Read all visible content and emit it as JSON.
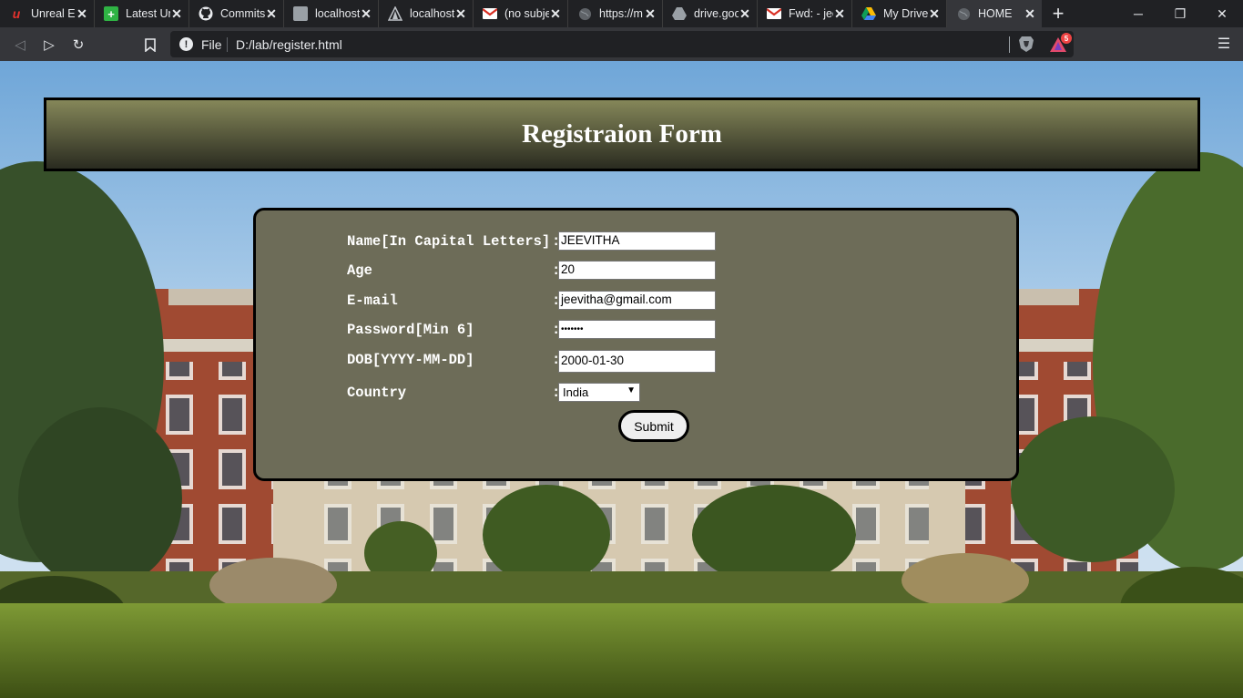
{
  "browser": {
    "tabs": [
      {
        "title": "Unreal En",
        "icon": "unreal-icon"
      },
      {
        "title": "Latest Un",
        "icon": "plus-green-icon"
      },
      {
        "title": "Commits",
        "icon": "github-icon"
      },
      {
        "title": "localhost",
        "icon": "phpmyadmin-icon"
      },
      {
        "title": "localhost",
        "icon": "triangle-icon"
      },
      {
        "title": "(no subje",
        "icon": "gmail-icon"
      },
      {
        "title": "https://m",
        "icon": "globe-icon"
      },
      {
        "title": "drive.goo",
        "icon": "drive-gray-icon"
      },
      {
        "title": "Fwd: - jee",
        "icon": "gmail-icon"
      },
      {
        "title": "My Drive",
        "icon": "google-drive-icon"
      },
      {
        "title": "HOME",
        "icon": "globe-icon",
        "active": true
      }
    ],
    "address": {
      "scheme_label": "File",
      "url": "D:/lab/register.html"
    },
    "rewards_badge": "5"
  },
  "page": {
    "header_title": "Registraion Form",
    "form": {
      "fields": [
        {
          "label": "Name[In Capital Letters]",
          "colon": ":",
          "value": "JEEVITHA"
        },
        {
          "label": "Age",
          "colon": ":",
          "value": "20"
        },
        {
          "label": "E-mail",
          "colon": ":",
          "value": "jeevitha@gmail.com"
        },
        {
          "label": "Password[Min 6]",
          "colon": ":",
          "value": "•••••••"
        },
        {
          "label": "DOB[YYYY-MM-DD]",
          "colon": ":",
          "value": "2000-01-30"
        },
        {
          "label": "Country",
          "colon": ":",
          "value": "India"
        }
      ],
      "submit_label": "Submit"
    }
  },
  "colors": {
    "header_gradient_top": "#858759",
    "header_gradient_bottom": "#2a2b20",
    "form_background": "#6d6c58",
    "browser_dark": "#202124",
    "browser_toolbar": "#35363a"
  }
}
